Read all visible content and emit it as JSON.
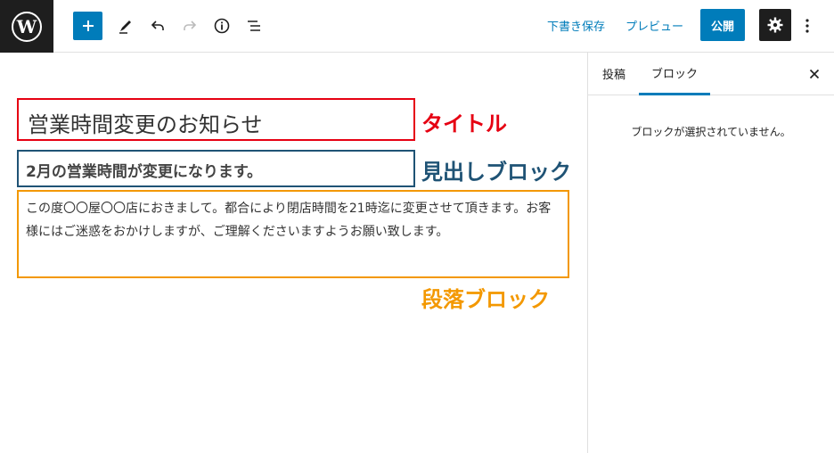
{
  "toolbar": {
    "logo_icon": "wordpress-logo-icon",
    "add_icon": "plus-icon",
    "tools_icon": "pencil-icon",
    "undo_icon": "undo-icon",
    "redo_icon": "redo-icon",
    "info_icon": "info-icon",
    "outline_icon": "list-view-icon",
    "save_draft_label": "下書き保存",
    "preview_label": "プレビュー",
    "publish_label": "公開",
    "settings_icon": "gear-icon",
    "more_icon": "more-vertical-icon"
  },
  "editor": {
    "title": "営業時間変更のお知らせ",
    "heading": "2月の営業時間が変更になります。",
    "paragraph": "この度〇〇屋〇〇店におきまして。都合により閉店時間を21時迄に変更させて頂きます。お客様にはご迷惑をおかけしますが、ご理解くださいますようお願い致します。",
    "annotations": {
      "title": "タイトル",
      "heading": "見出しブロック",
      "paragraph": "段落ブロック"
    },
    "colors": {
      "title_border": "#e60012",
      "heading_border": "#1f5375",
      "paragraph_border": "#f39800"
    }
  },
  "sidebar": {
    "tabs": [
      {
        "label": "投稿"
      },
      {
        "label": "ブロック"
      }
    ],
    "active_tab": "ブロック",
    "close_icon": "close-icon",
    "empty_message": "ブロックが選択されていません。"
  },
  "colors": {
    "accent": "#007cba",
    "dark": "#1e1e1e"
  }
}
